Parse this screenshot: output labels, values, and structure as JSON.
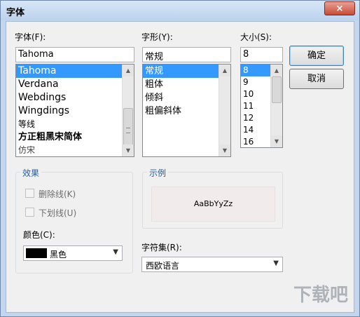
{
  "window": {
    "title": "字体",
    "close": "×"
  },
  "font": {
    "label": "字体(F):",
    "value": "Tahoma",
    "items": [
      "Tahoma",
      "Verdana",
      "Webdings",
      "Wingdings",
      "等线",
      "方正粗黑宋简体",
      "仿宋"
    ]
  },
  "style": {
    "label": "字形(Y):",
    "value": "常规",
    "items": [
      "常规",
      "粗体",
      "倾斜",
      "粗偏斜体"
    ]
  },
  "size": {
    "label": "大小(S):",
    "value": "8",
    "items": [
      "8",
      "9",
      "10",
      "11",
      "12",
      "14",
      "16"
    ]
  },
  "buttons": {
    "ok": "确定",
    "cancel": "取消"
  },
  "effects": {
    "label": "效果",
    "strikeout": "删除线(K)",
    "underline": "下划线(U)",
    "color_label": "颜色(C):",
    "color_value": "黑色",
    "color_hex": "#000000"
  },
  "sample": {
    "label": "示例",
    "text": "AaBbYyZz"
  },
  "charset": {
    "label": "字符集(R):",
    "value": "西欧语言"
  },
  "watermark": "下载吧"
}
